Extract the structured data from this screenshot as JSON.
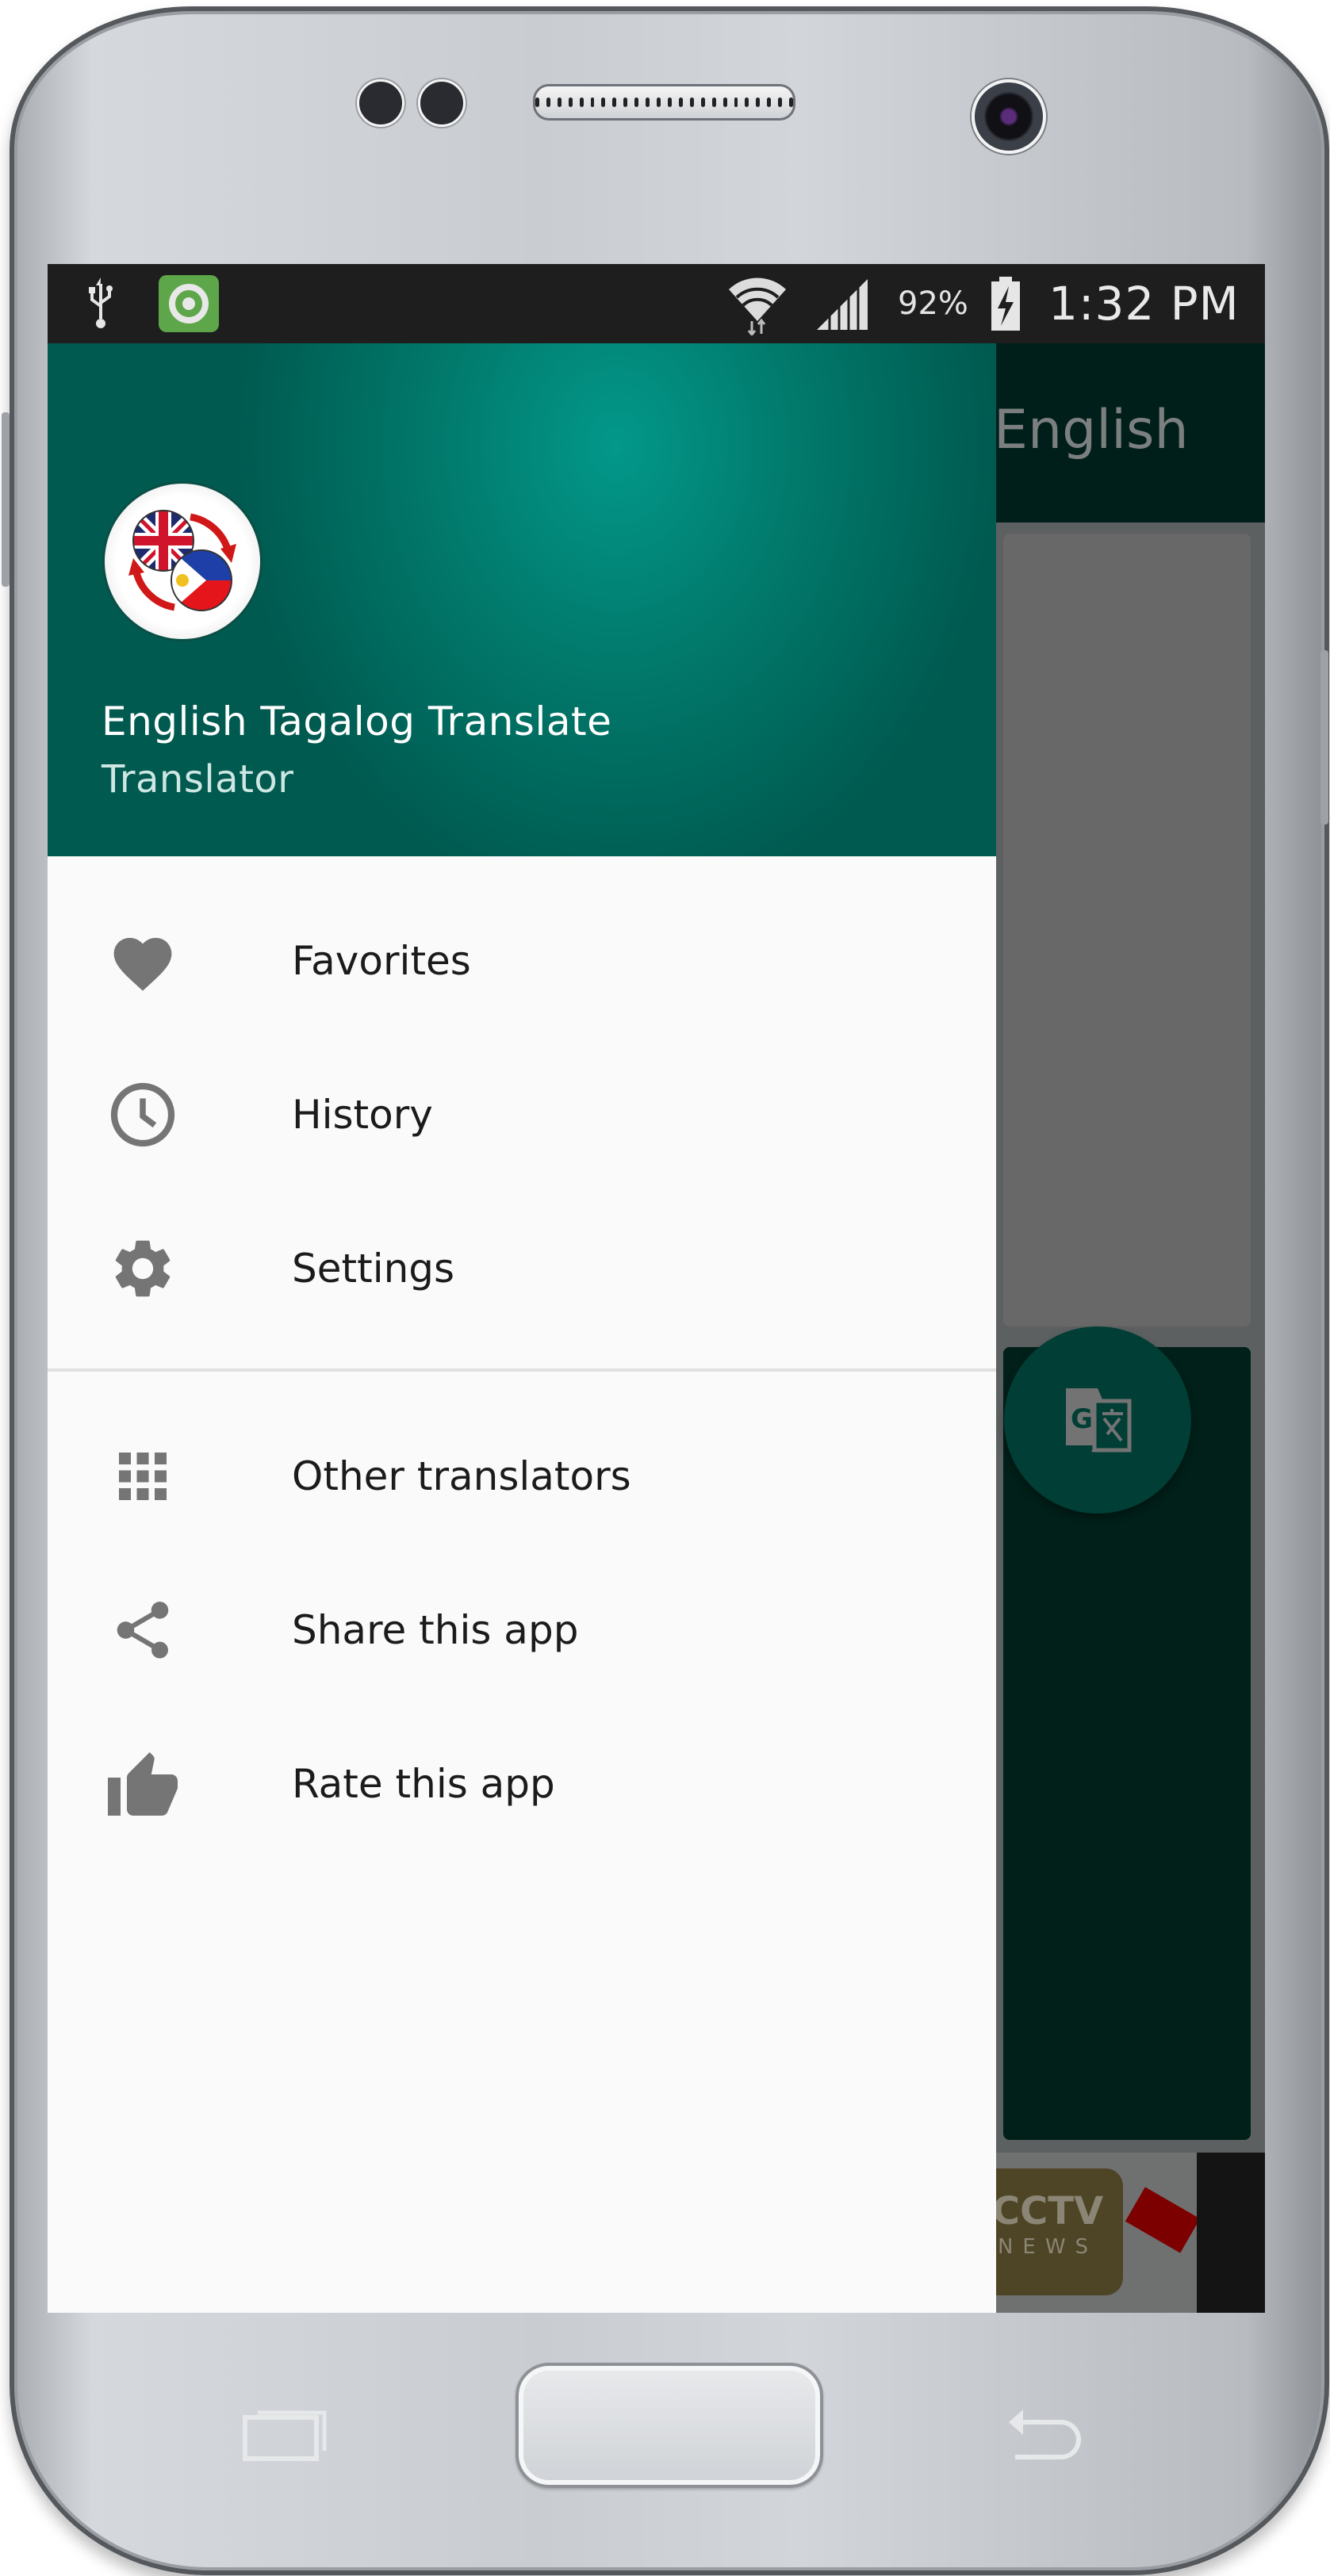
{
  "status_bar": {
    "left_icons": [
      "usb-icon",
      "app-notification-icon"
    ],
    "right_icons": [
      "wifi-icon",
      "signal-icon",
      "battery-charging-icon"
    ],
    "battery_text": "92%",
    "time": "1:32 PM"
  },
  "background_app": {
    "toolbar_title": "English",
    "fab_icon": "google-translate-icon",
    "ad": {
      "logo_text": "CCTV",
      "logo_subtext": "NEWS"
    }
  },
  "drawer": {
    "header": {
      "logo_icon": "english-tagalog-flags-icon",
      "title": "English Tagalog Translate",
      "subtitle": "Translator"
    },
    "primary_items": [
      {
        "label": "Favorites",
        "icon": "heart-icon"
      },
      {
        "label": "History",
        "icon": "clock-icon"
      },
      {
        "label": "Settings",
        "icon": "gear-icon"
      }
    ],
    "secondary_items": [
      {
        "label": "Other translators",
        "icon": "apps-grid-icon"
      },
      {
        "label": "Share this app",
        "icon": "share-icon"
      },
      {
        "label": "Rate this app",
        "icon": "thumbs-up-icon"
      }
    ]
  },
  "device_keys": {
    "recent": "recent-apps-key",
    "home": "home-key",
    "back": "back-key"
  },
  "colors": {
    "header_teal": "#009688",
    "status_bar": "#1e1e1e",
    "drawer_bg": "#fafafa",
    "icon_gray": "#757575",
    "text_dark": "#1b1b1b"
  }
}
